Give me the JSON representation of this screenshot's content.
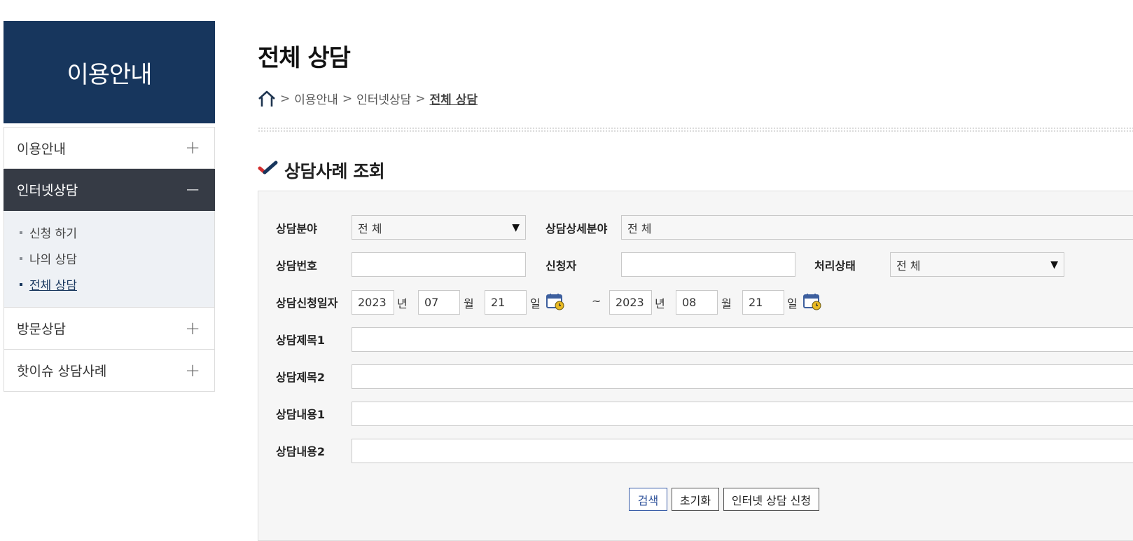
{
  "sidebar": {
    "header": "이용안내",
    "items": [
      {
        "label": "이용안내",
        "sign": "+"
      },
      {
        "label": "인터넷상담",
        "sign": "−"
      },
      {
        "label": "방문상담",
        "sign": "+"
      },
      {
        "label": "핫이슈 상담사례",
        "sign": "+"
      }
    ],
    "submenu": [
      {
        "label": "신청 하기"
      },
      {
        "label": "나의 상담"
      },
      {
        "label": "전체 상담"
      }
    ]
  },
  "page": {
    "title": "전체 상담",
    "breadcrumb": [
      "이용안내",
      "인터넷상담",
      "전체 상담"
    ],
    "breadcrumb_sep": ">",
    "section_title": "상담사례 조회"
  },
  "form": {
    "field_label": "상담분야",
    "field_value": "전 체",
    "detail_label": "상담상세분야",
    "detail_value": "전 체",
    "number_label": "상담번호",
    "number_value": "",
    "applicant_label": "신청자",
    "applicant_value": "",
    "status_label": "처리상태",
    "status_value": "전 체",
    "date_label": "상담신청일자",
    "from": {
      "year": "2023",
      "month": "07",
      "day": "21"
    },
    "to": {
      "year": "2023",
      "month": "08",
      "day": "21"
    },
    "unit_year": "년",
    "unit_month": "월",
    "unit_day": "일",
    "range_sep": "~",
    "title1_label": "상담제목1",
    "title2_label": "상담제목2",
    "content1_label": "상담내용1",
    "content2_label": "상담내용2"
  },
  "buttons": {
    "search": "검색",
    "reset": "초기화",
    "apply": "인터넷 상담 신청"
  },
  "icons": {
    "dropdown_arrow": "▼",
    "home": "home-icon",
    "calendar": "calendar-icon",
    "check": "check-icon"
  },
  "colors": {
    "brand_navy": "#17365d",
    "active_menu": "#363b45",
    "submenu_bg": "#eef1f5",
    "check_red": "#d32f2f"
  }
}
